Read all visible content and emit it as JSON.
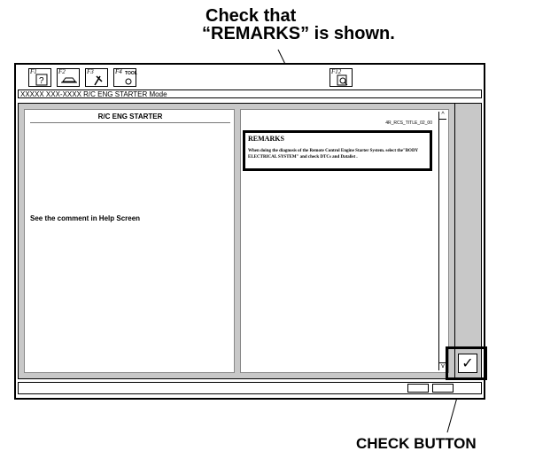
{
  "callouts": {
    "top_line1": "Check that",
    "top_line2": "“REMARKS” is shown.",
    "bottom": "CHECK BUTTON"
  },
  "toolbar": {
    "f1": "F1",
    "f2": "F2",
    "f3": "F3",
    "f4": "F4",
    "f4_text": "TOOL",
    "f12": "F12"
  },
  "mode_bar": "XXXXX XXX-XXXX R/C ENG STARTER Mode",
  "left_panel": {
    "header": "R/C ENG STARTER",
    "message": "See the comment in Help Screen"
  },
  "right_panel": {
    "doc_id": "4R_RCS_TITLE_02_00",
    "remarks_title": "REMARKS",
    "remarks_body": "When doing the diagnosis of the Remote Control Engine Starter System. select the\"BODY ELECTRICAL SYSTEM\" and check DTCs and Datalist ."
  },
  "check_button": "✓",
  "icons": {
    "f1": "help-icon",
    "f2": "car-icon",
    "f3": "tool-icon",
    "f4": "tool-menu-icon",
    "f12": "search-document-icon"
  }
}
